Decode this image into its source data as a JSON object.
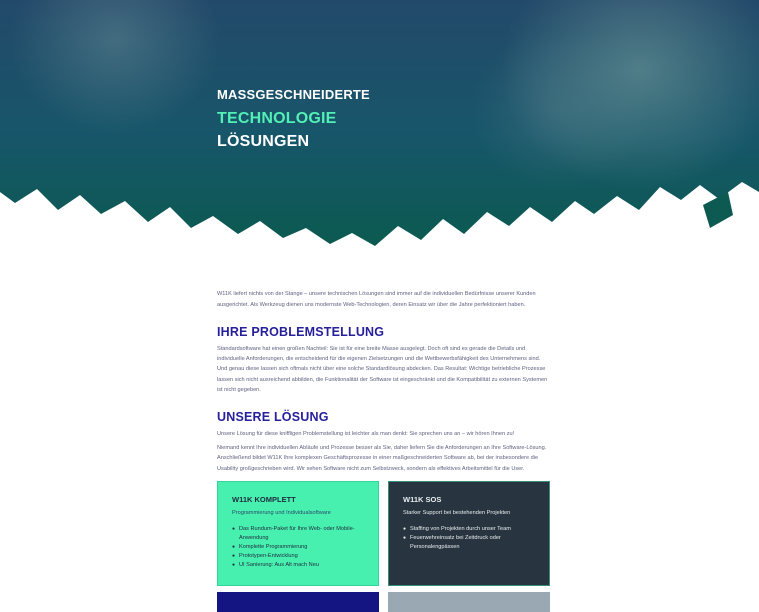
{
  "hero": {
    "line1": "MASSGESCHNEIDERTE",
    "line2": "TECHNOLOGIE",
    "line3": "LÖSUNGEN",
    "colors": {
      "accent": "#53f0b5",
      "overlay_top": "#1f4a63",
      "overlay_bottom": "#0e5a52"
    }
  },
  "intro": "W11K liefert nichts von der Stange – unsere technischen Lösungen sind immer auf die individuellen Bedürfnisse unserer Kunden ausgerichtet. Als Werkzeug dienen uns modernste Web-Technologien, deren Einsatz wir über die Jahre perfektioniert haben.",
  "problem": {
    "title": "IHRE PROBLEMSTELLUNG",
    "text": "Standardsoftware hat einen großen Nachteil: Sie ist für eine breite Masse ausgelegt. Doch oft sind es gerade die Details und individuelle Anforderungen, die entscheidend für die eigenen Zielsetzungen und die Wettbewerbsfähigkeit des Unternehmens sind. Und genau diese lassen sich oftmals nicht über eine solche Standardlösung abdecken. Das Resultat: Wichtige betriebliche Prozesse lassen sich nicht ausreichend abbilden, die Funktionalität der Software ist eingeschränkt und die Kompatibilität zu externen Systemen ist nicht gegeben."
  },
  "solution": {
    "title": "UNSERE LÖSUNG",
    "text1": "Unsere Lösung für diese kniffligen Problemstellung ist leichter als man denkt: Sie sprechen uns an – wir hören Ihnen zu!",
    "text2": "Niemand kennt Ihre individuellen Abläufe und Prozesse besser als Sie, daher liefern Sie die Anforderungen an Ihre Software-Lösung. Anschließend bildet W11K Ihre komplexen Geschäftsprozesse in einer maßgeschneiderten Software ab, bei der insbesondere die Usability großgeschrieben wird. Wir sehen Software nicht zum Selbstzweck, sondern als effektives Arbeitsmittel für die User."
  },
  "cards": [
    {
      "title": "W11K KOMPLETT",
      "subtitle": "Programmierung und Individualsoftware",
      "items": [
        "Das Rundum-Paket für Ihre Web- oder Mobile-Anwendung",
        "Komplette Programmierung",
        "Prototypen-Entwicklung",
        "UI Sanierung: Aus Alt mach Neu"
      ]
    },
    {
      "title": "W11K SOS",
      "subtitle": "Starker Support bei bestehenden Projekten",
      "items": [
        "Staffing von Projekten durch unser Team",
        "Feuerwehreinsatz bei Zeitdruck oder Personalengpässen"
      ]
    }
  ]
}
